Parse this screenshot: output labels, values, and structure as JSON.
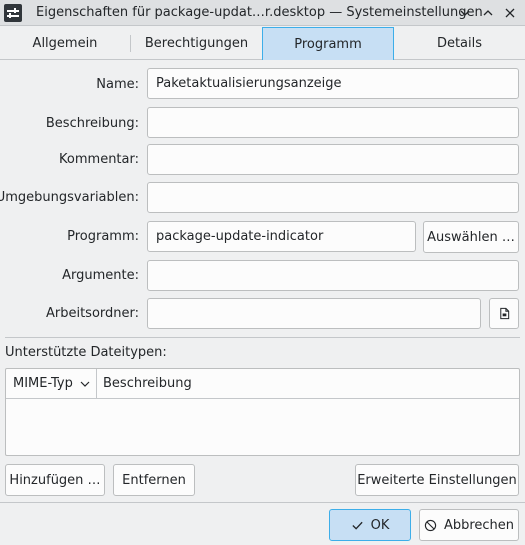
{
  "window": {
    "title": "Eigenschaften für package-updat…r.desktop — Systemeinstellungen",
    "app_icon": "settings-sliders-icon"
  },
  "titlebar_buttons": [
    {
      "name": "collapse",
      "icon": "chevron-down-icon"
    },
    {
      "name": "maximize",
      "icon": "chevron-up-icon"
    },
    {
      "name": "close",
      "icon": "close-icon"
    }
  ],
  "tabs": [
    {
      "label": "Allgemein",
      "active": false
    },
    {
      "label": "Berechtigungen",
      "active": false
    },
    {
      "label": "Programm",
      "active": true
    },
    {
      "label": "Details",
      "active": false
    }
  ],
  "form": {
    "name_label": "Name:",
    "name_value": "Paketaktualisierungsanzeige",
    "description_label": "Beschreibung:",
    "description_value": "",
    "comment_label": "Kommentar:",
    "comment_value": "",
    "env_label": "Umgebungsvariablen:",
    "env_value": "",
    "program_label": "Programm:",
    "program_value": "package-update-indicator",
    "choose_button": "Auswählen …",
    "arguments_label": "Argumente:",
    "arguments_value": "",
    "workdir_label": "Arbeitsordner:",
    "workdir_value": "",
    "workdir_browse_icon": "document-open-icon"
  },
  "filetypes": {
    "section_label": "Unterstützte Dateitypen:",
    "columns": [
      "MIME-Typ",
      "Beschreibung"
    ],
    "rows": [],
    "add_button": "Hinzufügen …",
    "remove_button": "Entfernen",
    "advanced_button": "Erweiterte Einstellungen"
  },
  "dialog_buttons": {
    "ok_label": "OK",
    "ok_icon": "checkmark-icon",
    "cancel_label": "Abbrechen",
    "cancel_icon": "cancel-icon"
  },
  "colors": {
    "accent": "#3daee9",
    "accent_bg": "#c7dff4",
    "window_bg": "#eff0f1",
    "titlebar_bg": "#dee0e2"
  }
}
